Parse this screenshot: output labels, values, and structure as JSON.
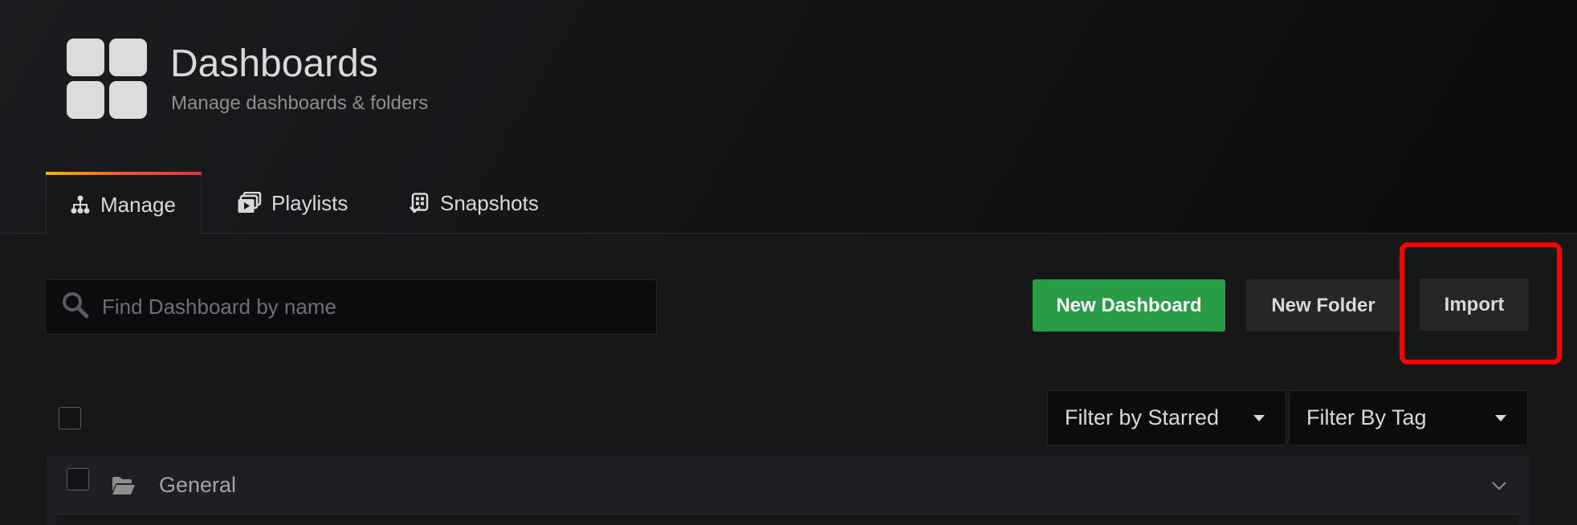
{
  "header": {
    "title": "Dashboards",
    "subtitle": "Manage dashboards & folders",
    "icon": "dashboard-grid-icon"
  },
  "tabs": [
    {
      "label": "Manage",
      "icon": "sitemap-icon",
      "active": true
    },
    {
      "label": "Playlists",
      "icon": "playlist-icon",
      "active": false
    },
    {
      "label": "Snapshots",
      "icon": "snapshot-icon",
      "active": false
    }
  ],
  "toolbar": {
    "search_placeholder": "Find Dashboard by name",
    "new_dashboard_label": "New Dashboard",
    "new_folder_label": "New Folder",
    "import_label": "Import"
  },
  "filters": {
    "starred_label": "Filter by Starred",
    "tag_label": "Filter By Tag"
  },
  "folders": [
    {
      "name": "General",
      "icon": "folder-open-icon"
    }
  ],
  "colors": {
    "primary_button": "#299c46",
    "tab_accent_start": "#ffb400",
    "tab_accent_end": "#e02f44",
    "highlight": "#ff0000"
  }
}
